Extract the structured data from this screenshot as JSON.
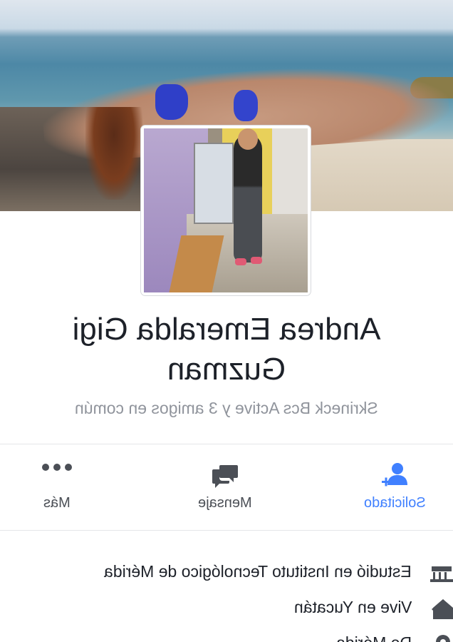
{
  "profile": {
    "name": "Andrea Emeralda Gigi Guzman",
    "mutual_friends": "Skrineck Bcs Active y 3 amigos en común"
  },
  "actions": [
    {
      "label": "Solicitado",
      "icon": "add-friend-requested-icon",
      "state": "active"
    },
    {
      "label": "Mensaje",
      "icon": "message-icon",
      "state": "normal"
    },
    {
      "label": "Más",
      "icon": "more-dots-icon",
      "state": "normal"
    }
  ],
  "about": [
    {
      "text": "Estudió en Instituto Tecnológico de Mérida",
      "icon": "school-icon"
    },
    {
      "text": "Vive en Yucatán",
      "icon": "home-icon"
    },
    {
      "text": "De Mérida",
      "icon": "location-pin-icon"
    }
  ],
  "colors": {
    "accent": "#4080ff",
    "text": "#1d2129",
    "muted": "#90949c",
    "icon": "#4b4f56"
  }
}
